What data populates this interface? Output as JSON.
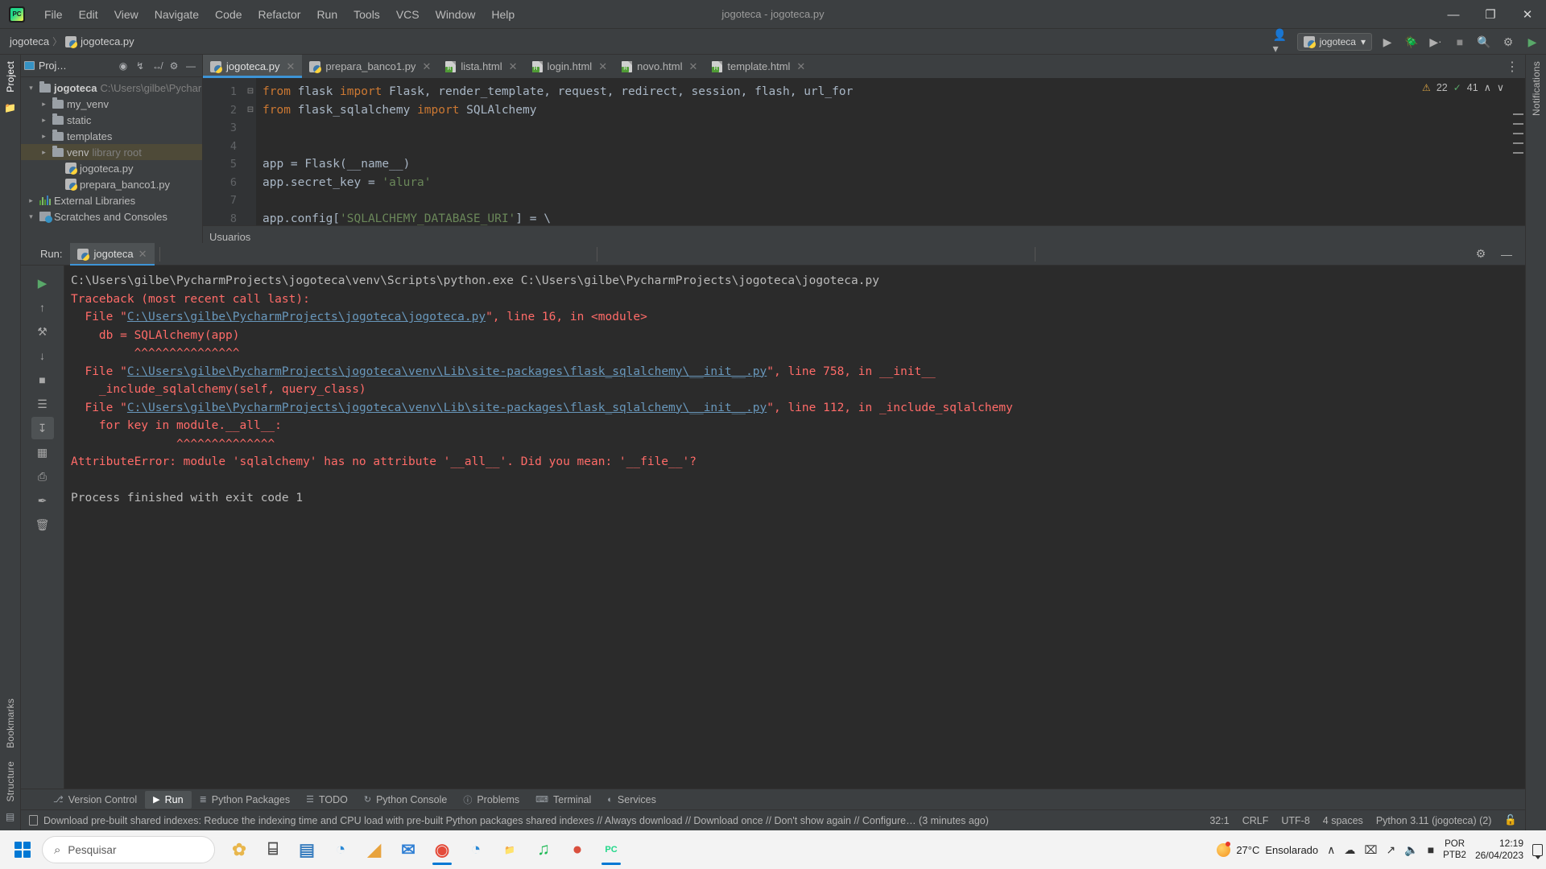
{
  "window": {
    "title": "jogoteca - jogoteca.py",
    "logo_text": "PC",
    "minimize": "—",
    "maximize": "❐",
    "close": "✕"
  },
  "menu": {
    "items": [
      "File",
      "Edit",
      "View",
      "Navigate",
      "Code",
      "Refactor",
      "Run",
      "Tools",
      "VCS",
      "Window",
      "Help"
    ]
  },
  "navbar": {
    "breadcrumbs": [
      "jogoteca",
      "jogoteca.py"
    ],
    "separator": "〉",
    "run_config": "jogoteca",
    "chevron": "▾",
    "icons": {
      "user": "user-icon",
      "run": "▶",
      "debug": "debug-icon",
      "coverage": "coverage-icon",
      "stop": "■",
      "search": "⌕",
      "settings": "⚙",
      "updates": "updates-icon"
    }
  },
  "left_strip": {
    "project_label": "Project",
    "bookmarks_label": "Bookmarks",
    "structure_label": "Structure"
  },
  "right_strip": {
    "notifications_label": "Notifications"
  },
  "project_panel": {
    "title": "Proj…",
    "tools": [
      "◉",
      "⤓",
      "⤒",
      "⚙",
      "—"
    ],
    "tree": [
      {
        "label": "jogoteca",
        "suffix": "C:\\Users\\gilbe\\Pychar",
        "type": "folder",
        "arrow": "open",
        "bold": true,
        "indent": 0,
        "selected": false
      },
      {
        "label": "my_venv",
        "suffix": "",
        "type": "folder",
        "arrow": "closed",
        "bold": false,
        "indent": 1,
        "selected": false
      },
      {
        "label": "static",
        "suffix": "",
        "type": "folder",
        "arrow": "closed",
        "bold": false,
        "indent": 1,
        "selected": false
      },
      {
        "label": "templates",
        "suffix": "",
        "type": "folder",
        "arrow": "closed",
        "bold": false,
        "indent": 1,
        "selected": false
      },
      {
        "label": "venv",
        "suffix": "library root",
        "type": "folder",
        "arrow": "closed",
        "bold": false,
        "indent": 1,
        "selected": true
      },
      {
        "label": "jogoteca.py",
        "suffix": "",
        "type": "python",
        "arrow": "none",
        "bold": false,
        "indent": 2,
        "selected": false
      },
      {
        "label": "prepara_banco1.py",
        "suffix": "",
        "type": "python",
        "arrow": "none",
        "bold": false,
        "indent": 2,
        "selected": false
      },
      {
        "label": "External Libraries",
        "suffix": "",
        "type": "libraries",
        "arrow": "closed",
        "bold": false,
        "indent": 0,
        "selected": false
      },
      {
        "label": "Scratches and Consoles",
        "suffix": "",
        "type": "scratches",
        "arrow": "open",
        "bold": false,
        "indent": 0,
        "selected": false
      }
    ]
  },
  "editor": {
    "tabs": [
      {
        "label": "jogoteca.py",
        "type": "python",
        "active": true
      },
      {
        "label": "prepara_banco1.py",
        "type": "python",
        "active": false
      },
      {
        "label": "lista.html",
        "type": "html",
        "active": false
      },
      {
        "label": "login.html",
        "type": "html",
        "active": false
      },
      {
        "label": "novo.html",
        "type": "html",
        "active": false
      },
      {
        "label": "template.html",
        "type": "html",
        "active": false
      }
    ],
    "close_glyph": "✕",
    "more_glyph": "⋮",
    "inspection": {
      "warnings": "22",
      "warn_glyph": "⚠",
      "oks": "41",
      "ok_glyph": "✓",
      "chevron_up": "∧",
      "chevron_down": "∨"
    },
    "breadcrumb": "Usuarios",
    "line_numbers": [
      "1",
      "2",
      "3",
      "4",
      "5",
      "6",
      "7",
      "8"
    ],
    "lines": [
      {
        "n": 1,
        "tokens": [
          {
            "t": "from",
            "c": "k"
          },
          {
            "t": " flask ",
            "c": "n"
          },
          {
            "t": "import",
            "c": "k"
          },
          {
            "t": " Flask, render_template, request, redirect, session, flash, url_for",
            "c": "n"
          }
        ]
      },
      {
        "n": 2,
        "tokens": [
          {
            "t": "from",
            "c": "k"
          },
          {
            "t": " flask_sqlalchemy ",
            "c": "n"
          },
          {
            "t": "import",
            "c": "k"
          },
          {
            "t": " SQLAlchemy",
            "c": "n"
          }
        ]
      },
      {
        "n": 3,
        "tokens": []
      },
      {
        "n": 4,
        "tokens": [
          {
            "t": "",
            "c": "n"
          }
        ]
      },
      {
        "n": 5,
        "tokens": [
          {
            "t": "app = Flask(__name__)",
            "c": "n"
          }
        ]
      },
      {
        "n": 6,
        "tokens": [
          {
            "t": "app.secret_key = ",
            "c": "n"
          },
          {
            "t": "'alura'",
            "c": "s"
          }
        ]
      },
      {
        "n": 7,
        "tokens": []
      },
      {
        "n": 8,
        "tokens": [
          {
            "t": "app.config[",
            "c": "n"
          },
          {
            "t": "'SQLALCHEMY_DATABASE_URI'",
            "c": "s"
          },
          {
            "t": "] = \\",
            "c": "n"
          }
        ]
      }
    ]
  },
  "run_panel": {
    "label": "Run:",
    "tab_label": "jogoteca",
    "close_glyph": "✕",
    "settings_glyph": "⚙",
    "minimize_glyph": "—",
    "side_icons": [
      {
        "name": "rerun-icon",
        "glyph": "▶"
      },
      {
        "name": "up-arrow-icon",
        "glyph": "↑"
      },
      {
        "name": "wrench-icon",
        "glyph": "⚒"
      },
      {
        "name": "down-arrow-icon",
        "glyph": "↓"
      },
      {
        "name": "stop-icon",
        "glyph": "■"
      },
      {
        "name": "wrap-text-icon",
        "glyph": "☰"
      },
      {
        "name": "scroll-end-icon",
        "glyph": "↧"
      },
      {
        "name": "grid-icon",
        "glyph": "▦"
      },
      {
        "name": "print-icon",
        "glyph": "⎙"
      },
      {
        "name": "pin-icon",
        "glyph": "✒"
      },
      {
        "name": "trash-icon",
        "glyph": "🗑"
      }
    ],
    "console": [
      {
        "c": "plain",
        "t": "C:\\Users\\gilbe\\PycharmProjects\\jogoteca\\venv\\Scripts\\python.exe C:\\Users\\gilbe\\PycharmProjects\\jogoteca\\jogoteca.py"
      },
      {
        "c": "err",
        "t": "Traceback (most recent call last):"
      },
      {
        "c": "mixed",
        "parts": [
          {
            "c": "err",
            "t": "  File \""
          },
          {
            "c": "lnk",
            "t": "C:\\Users\\gilbe\\PycharmProjects\\jogoteca\\jogoteca.py"
          },
          {
            "c": "err",
            "t": "\", line 16, in <module>"
          }
        ]
      },
      {
        "c": "err",
        "t": "    db = SQLAlchemy(app)"
      },
      {
        "c": "err",
        "t": "         ^^^^^^^^^^^^^^^"
      },
      {
        "c": "mixed",
        "parts": [
          {
            "c": "err",
            "t": "  File \""
          },
          {
            "c": "lnk",
            "t": "C:\\Users\\gilbe\\PycharmProjects\\jogoteca\\venv\\Lib\\site-packages\\flask_sqlalchemy\\__init__.py"
          },
          {
            "c": "err",
            "t": "\", line 758, in __init__"
          }
        ]
      },
      {
        "c": "err",
        "t": "    _include_sqlalchemy(self, query_class)"
      },
      {
        "c": "mixed",
        "parts": [
          {
            "c": "err",
            "t": "  File \""
          },
          {
            "c": "lnk",
            "t": "C:\\Users\\gilbe\\PycharmProjects\\jogoteca\\venv\\Lib\\site-packages\\flask_sqlalchemy\\__init__.py"
          },
          {
            "c": "err",
            "t": "\", line 112, in _include_sqlalchemy"
          }
        ]
      },
      {
        "c": "err",
        "t": "    for key in module.__all__:"
      },
      {
        "c": "err",
        "t": "               ^^^^^^^^^^^^^^"
      },
      {
        "c": "err",
        "t": "AttributeError: module 'sqlalchemy' has no attribute '__all__'. Did you mean: '__file__'?"
      },
      {
        "c": "blank",
        "t": ""
      },
      {
        "c": "plain",
        "t": "Process finished with exit code 1"
      }
    ]
  },
  "tool_windows": [
    {
      "label": "Version Control",
      "icon": "branch-icon",
      "glyph": "⎇",
      "active": false
    },
    {
      "label": "Run",
      "icon": "run-icon",
      "glyph": "▶",
      "active": true
    },
    {
      "label": "Python Packages",
      "icon": "packages-icon",
      "glyph": "≣",
      "active": false
    },
    {
      "label": "TODO",
      "icon": "todo-icon",
      "glyph": "☰",
      "active": false
    },
    {
      "label": "Python Console",
      "icon": "python-console-icon",
      "glyph": "↻",
      "active": false
    },
    {
      "label": "Problems",
      "icon": "problems-icon",
      "glyph": "ⓘ",
      "active": false
    },
    {
      "label": "Terminal",
      "icon": "terminal-icon",
      "glyph": "⌨",
      "active": false
    },
    {
      "label": "Services",
      "icon": "services-icon",
      "glyph": "◐",
      "active": false
    }
  ],
  "status_bar": {
    "message": "Download pre-built shared indexes: Reduce the indexing time and CPU load with pre-built Python packages shared indexes // Always download // Download once // Don't show again // Configure… (3 minutes ago)",
    "caret": "32:1",
    "line_sep": "CRLF",
    "encoding": "UTF-8",
    "indent": "4 spaces",
    "interpreter": "Python 3.11 (jogoteca) (2)",
    "lock_glyph": "🔓"
  },
  "taskbar": {
    "search_placeholder": "Pesquisar",
    "search_glyph": "⌕",
    "apps": [
      {
        "name": "widgets-icon",
        "glyph": "✿",
        "color": "#e8b64c",
        "active": false
      },
      {
        "name": "task-view-icon",
        "glyph": "⌸",
        "color": "#4a4a4a",
        "active": false
      },
      {
        "name": "store-icon",
        "glyph": "▤",
        "color": "#3a7ebf",
        "active": false
      },
      {
        "name": "edge-icon",
        "glyph": "◔",
        "color": "#2c8ad6",
        "active": false
      },
      {
        "name": "sublime-icon",
        "glyph": "◢",
        "color": "#e8a33d",
        "active": false
      },
      {
        "name": "mail-icon",
        "glyph": "✉",
        "color": "#2f7fd4",
        "active": false
      },
      {
        "name": "chrome-icon",
        "glyph": "◉",
        "color": "#e44b3a",
        "active": true
      },
      {
        "name": "edge-dev-icon",
        "glyph": "◔",
        "color": "#2c8ad6",
        "active": false
      },
      {
        "name": "explorer-icon",
        "glyph": "📁",
        "color": "#f0b429",
        "active": false
      },
      {
        "name": "spotify-icon",
        "glyph": "♫",
        "color": "#1db954",
        "active": false
      },
      {
        "name": "meet-icon",
        "glyph": "●",
        "color": "#d94f3d",
        "active": false
      },
      {
        "name": "pycharm-icon",
        "glyph": "PC",
        "color": "#21d789",
        "active": true
      }
    ],
    "weather": {
      "temp": "27°C",
      "desc": "Ensolarado"
    },
    "tray": {
      "chevron": "∧",
      "cloud": "☁",
      "device": "⌧",
      "wifi": "📶",
      "volume": "🔊",
      "battery": "▮"
    },
    "language": {
      "line1": "POR",
      "line2": "PTB2"
    },
    "clock": {
      "time": "12:19",
      "date": "26/04/2023"
    }
  }
}
